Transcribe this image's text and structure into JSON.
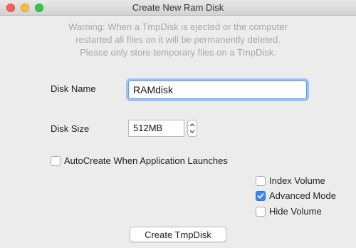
{
  "window": {
    "title": "Create New Ram Disk",
    "controls": [
      "close",
      "minimize",
      "zoom"
    ]
  },
  "warning": {
    "line1": "Warning: When a TmpDisk is ejected or the computer",
    "line2": "restarted all files on it will be permanently deleted.",
    "line3": "Please only store temporary files on a TmpDisk."
  },
  "form": {
    "disk_name_label": "Disk Name",
    "disk_name_value": "RAMdisk",
    "disk_size_label": "Disk Size",
    "disk_size_value": "512MB"
  },
  "options": {
    "autocreate": {
      "label": "AutoCreate When Application Launches",
      "checked": false
    },
    "index_volume": {
      "label": "Index Volume",
      "checked": false
    },
    "advanced_mode": {
      "label": "Advanced Mode",
      "checked": true
    },
    "hide_volume": {
      "label": "Hide Volume",
      "checked": false
    }
  },
  "actions": {
    "create_label": "Create TmpDisk"
  },
  "colors": {
    "accent": "#3b86f7",
    "focus_ring": "#9ec3f3",
    "warning_text": "#a8a8a8"
  }
}
